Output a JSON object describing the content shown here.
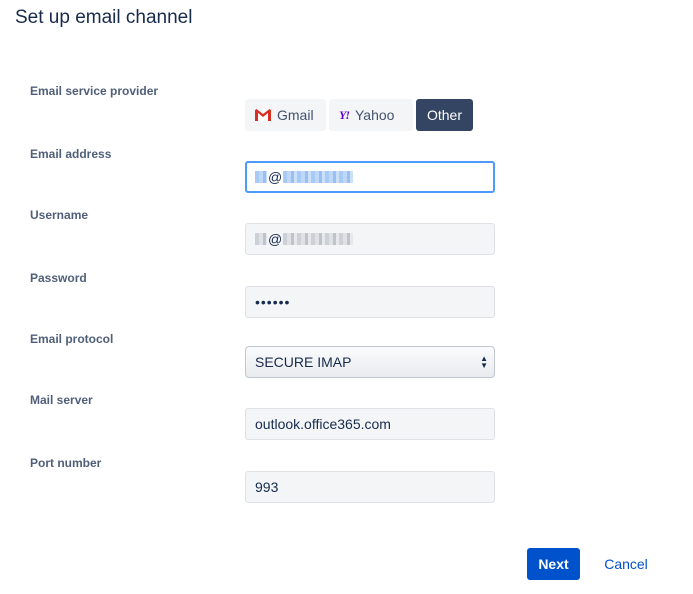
{
  "page": {
    "title": "Set up email channel"
  },
  "form": {
    "provider_label": "Email service provider",
    "providers": [
      {
        "label": "Gmail",
        "icon": "gmail-icon",
        "selected": false
      },
      {
        "label": "Yahoo",
        "icon": "yahoo-icon",
        "selected": false
      },
      {
        "label": "Other",
        "icon": "",
        "selected": true
      }
    ],
    "email_label": "Email address",
    "email_value_visible": "@",
    "username_label": "Username",
    "username_value_visible": "@",
    "password_label": "Password",
    "password_value": "••••••",
    "protocol_label": "Email protocol",
    "protocol_value": "SECURE IMAP",
    "server_label": "Mail server",
    "server_value": "outlook.office365.com",
    "port_label": "Port number",
    "port_value": "993"
  },
  "actions": {
    "next_label": "Next",
    "cancel_label": "Cancel"
  },
  "colors": {
    "primary": "#0052cc",
    "selected_provider": "#344563",
    "focus_ring": "#4c9aff"
  }
}
